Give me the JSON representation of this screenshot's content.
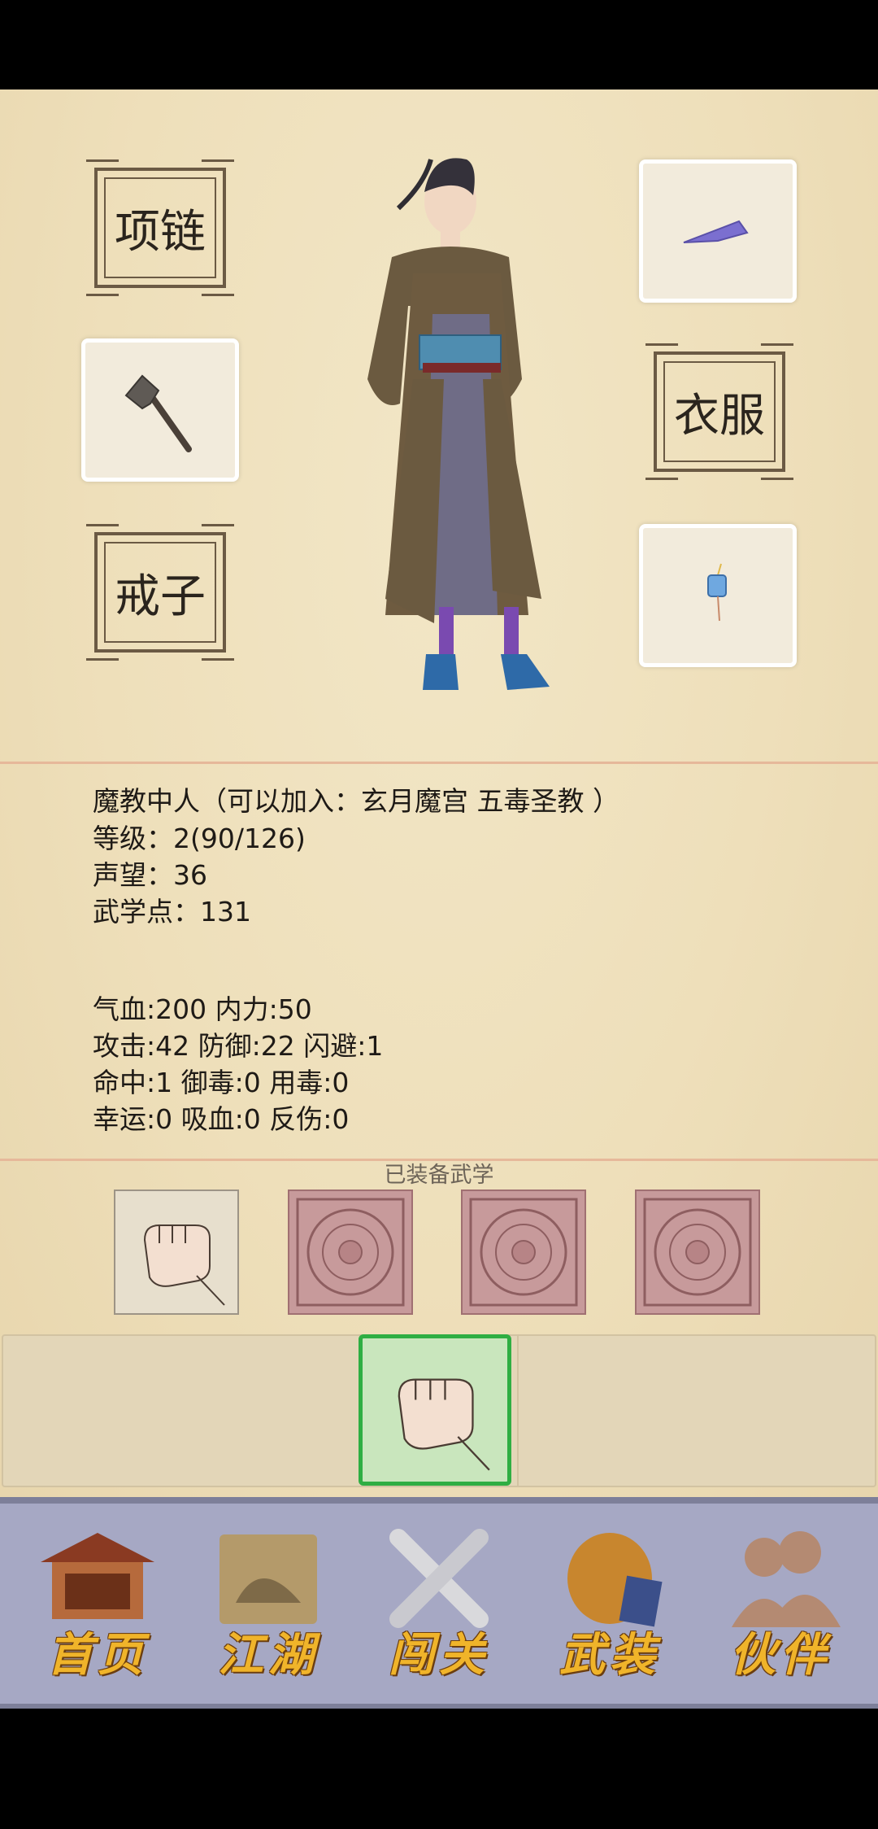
{
  "equipment": {
    "necklace_label": "项链",
    "clothes_label": "衣服",
    "ring_label": "戒子"
  },
  "character": {
    "sect_line": "魔教中人（可以加入：玄月魔宫 五毒圣教 ）",
    "level_line": "等级：2(90/126)",
    "reputation_line": "声望：36",
    "martial_points_line": "武学点：131"
  },
  "stats": {
    "line1": "气血:200  内力:50",
    "line2": "攻击:42  防御:22  闪避:1",
    "line3": "命中:1  御毒:0  用毒:0",
    "line4": "幸运:0  吸血:0  反伤:0"
  },
  "skills": {
    "title": "已装备武学"
  },
  "nav": {
    "items": [
      {
        "label": "首页",
        "icon": "temple-icon"
      },
      {
        "label": "江湖",
        "icon": "scroll-map-icon"
      },
      {
        "label": "闯关",
        "icon": "crossed-swords-icon"
      },
      {
        "label": "武装",
        "icon": "armor-icon"
      },
      {
        "label": "伙伴",
        "icon": "companions-icon"
      }
    ]
  },
  "colors": {
    "parchment": "#eedfba",
    "divider": "#e6b89a",
    "active_border": "#2fae43",
    "nav_bg": "#a6a8c4",
    "nav_text": "#f0b42a"
  }
}
